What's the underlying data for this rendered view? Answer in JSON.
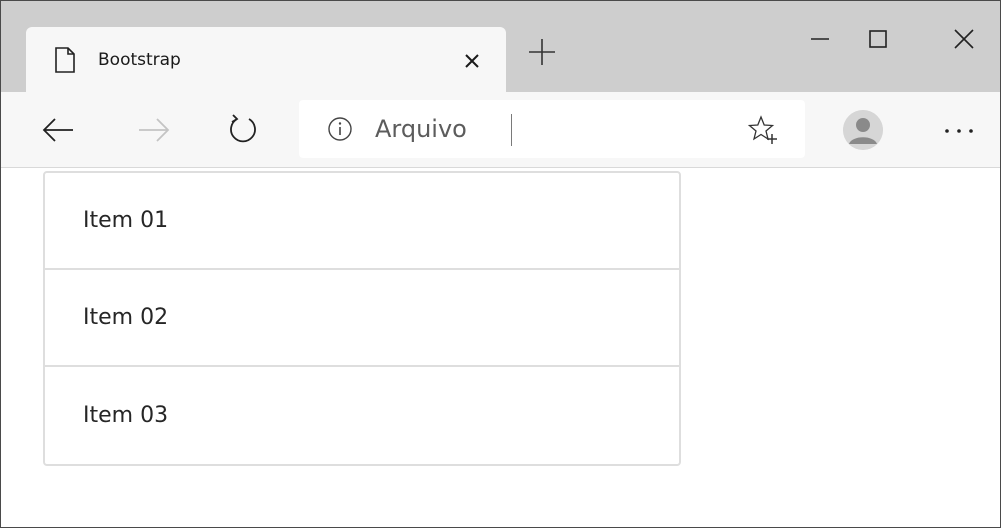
{
  "browser": {
    "tab": {
      "title": "Bootstrap",
      "close_symbol": "×",
      "icon": "document-icon"
    },
    "new_tab_icon": "plus-icon",
    "window_controls": {
      "minimize_icon": "minimize-icon",
      "maximize_icon": "maximize-icon",
      "close_icon": "close-icon"
    },
    "toolbar": {
      "back_icon": "arrow-left-icon",
      "forward_icon": "arrow-right-icon",
      "refresh_icon": "refresh-icon",
      "address": {
        "info_icon": "info-icon",
        "site_label": "Arquivo",
        "favorite_icon": "star-plus-icon"
      },
      "profile_icon": "avatar-icon",
      "more_label": "···"
    }
  },
  "page": {
    "list": {
      "items": [
        {
          "label": "Item 01"
        },
        {
          "label": "Item 02"
        },
        {
          "label": "Item 03"
        }
      ]
    }
  },
  "colors": {
    "tabstrip": "#cecece",
    "toolbar": "#f7f7f7",
    "list_border": "#dedede",
    "text": "#262626"
  }
}
